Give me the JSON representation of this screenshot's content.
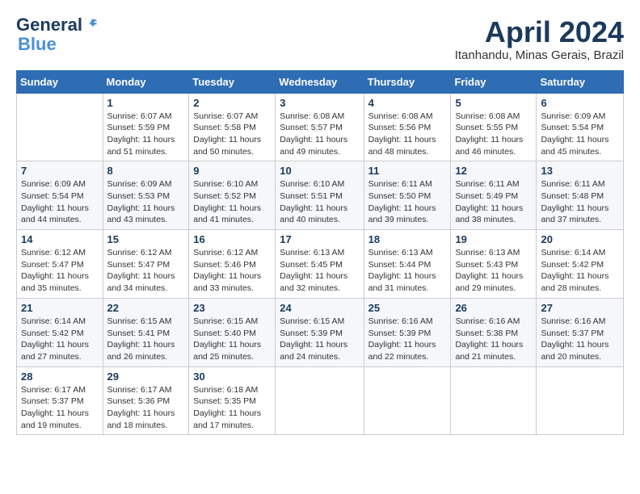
{
  "header": {
    "logo_general": "General",
    "logo_blue": "Blue",
    "month_title": "April 2024",
    "location": "Itanhandu, Minas Gerais, Brazil"
  },
  "days_of_week": [
    "Sunday",
    "Monday",
    "Tuesday",
    "Wednesday",
    "Thursday",
    "Friday",
    "Saturday"
  ],
  "weeks": [
    [
      {
        "day": "",
        "info": ""
      },
      {
        "day": "1",
        "info": "Sunrise: 6:07 AM\nSunset: 5:59 PM\nDaylight: 11 hours\nand 51 minutes."
      },
      {
        "day": "2",
        "info": "Sunrise: 6:07 AM\nSunset: 5:58 PM\nDaylight: 11 hours\nand 50 minutes."
      },
      {
        "day": "3",
        "info": "Sunrise: 6:08 AM\nSunset: 5:57 PM\nDaylight: 11 hours\nand 49 minutes."
      },
      {
        "day": "4",
        "info": "Sunrise: 6:08 AM\nSunset: 5:56 PM\nDaylight: 11 hours\nand 48 minutes."
      },
      {
        "day": "5",
        "info": "Sunrise: 6:08 AM\nSunset: 5:55 PM\nDaylight: 11 hours\nand 46 minutes."
      },
      {
        "day": "6",
        "info": "Sunrise: 6:09 AM\nSunset: 5:54 PM\nDaylight: 11 hours\nand 45 minutes."
      }
    ],
    [
      {
        "day": "7",
        "info": "Sunrise: 6:09 AM\nSunset: 5:54 PM\nDaylight: 11 hours\nand 44 minutes."
      },
      {
        "day": "8",
        "info": "Sunrise: 6:09 AM\nSunset: 5:53 PM\nDaylight: 11 hours\nand 43 minutes."
      },
      {
        "day": "9",
        "info": "Sunrise: 6:10 AM\nSunset: 5:52 PM\nDaylight: 11 hours\nand 41 minutes."
      },
      {
        "day": "10",
        "info": "Sunrise: 6:10 AM\nSunset: 5:51 PM\nDaylight: 11 hours\nand 40 minutes."
      },
      {
        "day": "11",
        "info": "Sunrise: 6:11 AM\nSunset: 5:50 PM\nDaylight: 11 hours\nand 39 minutes."
      },
      {
        "day": "12",
        "info": "Sunrise: 6:11 AM\nSunset: 5:49 PM\nDaylight: 11 hours\nand 38 minutes."
      },
      {
        "day": "13",
        "info": "Sunrise: 6:11 AM\nSunset: 5:48 PM\nDaylight: 11 hours\nand 37 minutes."
      }
    ],
    [
      {
        "day": "14",
        "info": "Sunrise: 6:12 AM\nSunset: 5:47 PM\nDaylight: 11 hours\nand 35 minutes."
      },
      {
        "day": "15",
        "info": "Sunrise: 6:12 AM\nSunset: 5:47 PM\nDaylight: 11 hours\nand 34 minutes."
      },
      {
        "day": "16",
        "info": "Sunrise: 6:12 AM\nSunset: 5:46 PM\nDaylight: 11 hours\nand 33 minutes."
      },
      {
        "day": "17",
        "info": "Sunrise: 6:13 AM\nSunset: 5:45 PM\nDaylight: 11 hours\nand 32 minutes."
      },
      {
        "day": "18",
        "info": "Sunrise: 6:13 AM\nSunset: 5:44 PM\nDaylight: 11 hours\nand 31 minutes."
      },
      {
        "day": "19",
        "info": "Sunrise: 6:13 AM\nSunset: 5:43 PM\nDaylight: 11 hours\nand 29 minutes."
      },
      {
        "day": "20",
        "info": "Sunrise: 6:14 AM\nSunset: 5:42 PM\nDaylight: 11 hours\nand 28 minutes."
      }
    ],
    [
      {
        "day": "21",
        "info": "Sunrise: 6:14 AM\nSunset: 5:42 PM\nDaylight: 11 hours\nand 27 minutes."
      },
      {
        "day": "22",
        "info": "Sunrise: 6:15 AM\nSunset: 5:41 PM\nDaylight: 11 hours\nand 26 minutes."
      },
      {
        "day": "23",
        "info": "Sunrise: 6:15 AM\nSunset: 5:40 PM\nDaylight: 11 hours\nand 25 minutes."
      },
      {
        "day": "24",
        "info": "Sunrise: 6:15 AM\nSunset: 5:39 PM\nDaylight: 11 hours\nand 24 minutes."
      },
      {
        "day": "25",
        "info": "Sunrise: 6:16 AM\nSunset: 5:39 PM\nDaylight: 11 hours\nand 22 minutes."
      },
      {
        "day": "26",
        "info": "Sunrise: 6:16 AM\nSunset: 5:38 PM\nDaylight: 11 hours\nand 21 minutes."
      },
      {
        "day": "27",
        "info": "Sunrise: 6:16 AM\nSunset: 5:37 PM\nDaylight: 11 hours\nand 20 minutes."
      }
    ],
    [
      {
        "day": "28",
        "info": "Sunrise: 6:17 AM\nSunset: 5:37 PM\nDaylight: 11 hours\nand 19 minutes."
      },
      {
        "day": "29",
        "info": "Sunrise: 6:17 AM\nSunset: 5:36 PM\nDaylight: 11 hours\nand 18 minutes."
      },
      {
        "day": "30",
        "info": "Sunrise: 6:18 AM\nSunset: 5:35 PM\nDaylight: 11 hours\nand 17 minutes."
      },
      {
        "day": "",
        "info": ""
      },
      {
        "day": "",
        "info": ""
      },
      {
        "day": "",
        "info": ""
      },
      {
        "day": "",
        "info": ""
      }
    ]
  ]
}
